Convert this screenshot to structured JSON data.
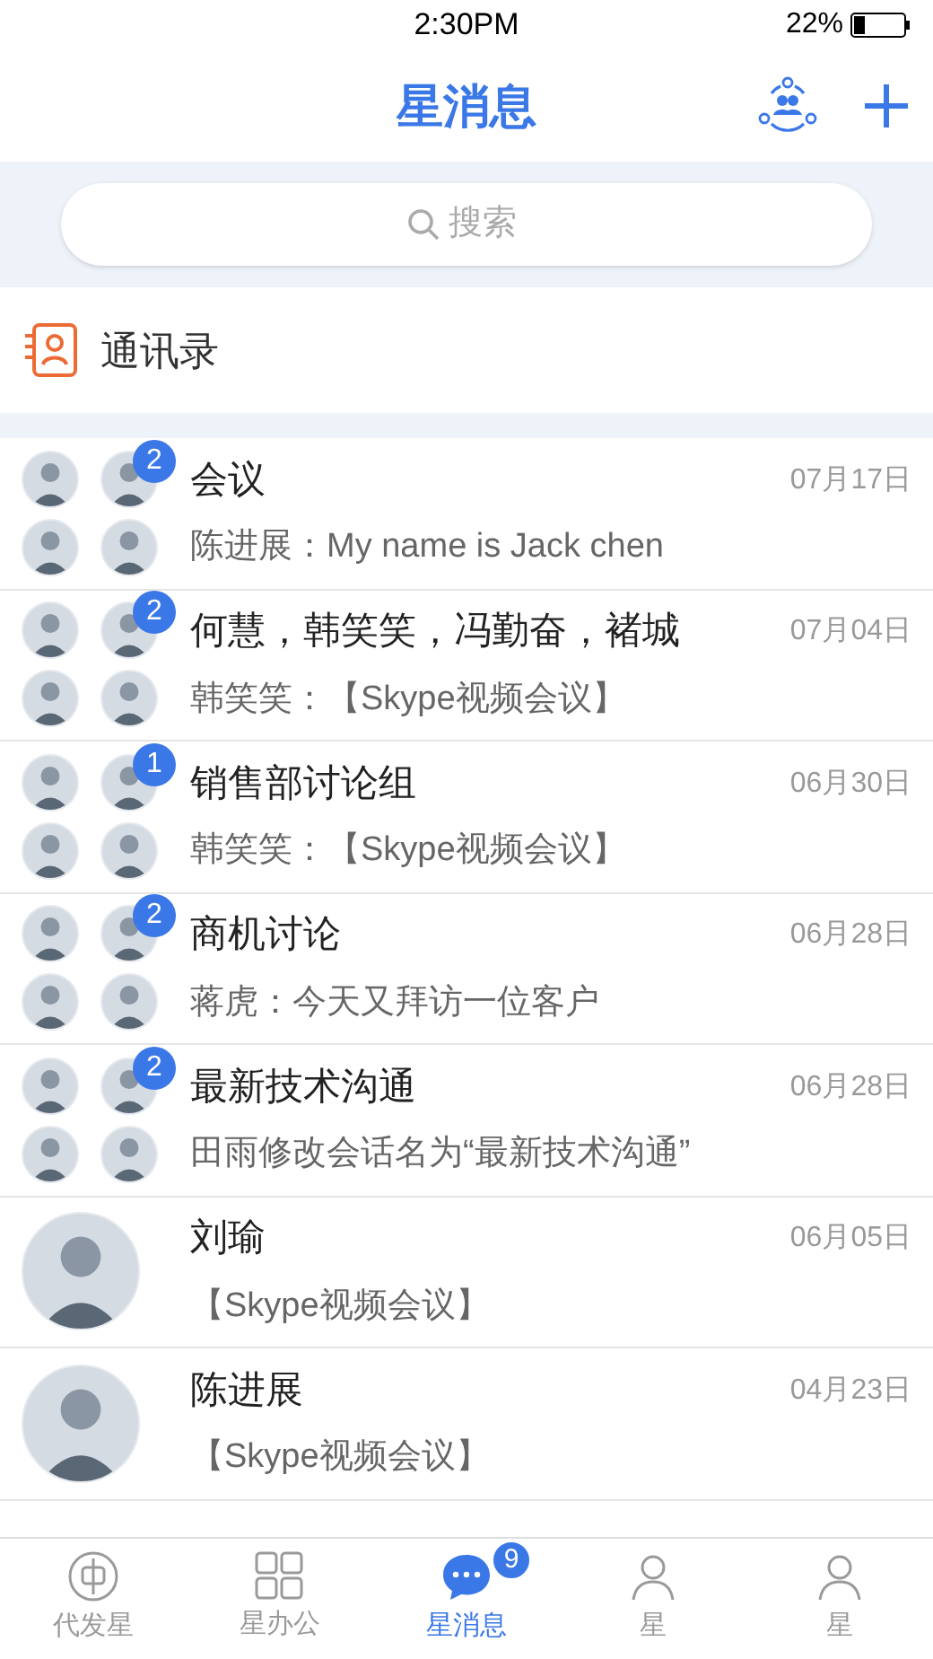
{
  "status_bar": {
    "time": "2:30PM",
    "battery": "22%"
  },
  "header": {
    "title": "星消息"
  },
  "search": {
    "placeholder": "搜索"
  },
  "contacts": {
    "label": "通讯录"
  },
  "conversations": [
    {
      "kind": "group",
      "name": "会议",
      "preview": "陈进展：My name is Jack chen",
      "date": "07月17日",
      "unread": "2"
    },
    {
      "kind": "group",
      "name": "何慧，韩笑笑，冯勤奋，褚城",
      "preview": "韩笑笑：【Skype视频会议】",
      "date": "07月04日",
      "unread": "2"
    },
    {
      "kind": "group",
      "name": "销售部讨论组",
      "preview": "韩笑笑：【Skype视频会议】",
      "date": "06月30日",
      "unread": "1"
    },
    {
      "kind": "group",
      "name": "商机讨论",
      "preview": "蒋虎：今天又拜访一位客户",
      "date": "06月28日",
      "unread": "2"
    },
    {
      "kind": "group",
      "name": "最新技术沟通",
      "preview": "田雨修改会话名为“最新技术沟通”",
      "date": "06月28日",
      "unread": "2"
    },
    {
      "kind": "person",
      "name": "刘瑜",
      "preview": "【Skype视频会议】",
      "date": "06月05日"
    },
    {
      "kind": "person",
      "name": "陈进展",
      "preview": "【Skype视频会议】",
      "date": "04月23日"
    }
  ],
  "tabs": [
    {
      "kind": "coin",
      "label": "代发星",
      "selected": false
    },
    {
      "kind": "grid",
      "label": "星办公",
      "selected": false
    },
    {
      "kind": "chat",
      "label": "星消息",
      "selected": true,
      "badge": "9"
    },
    {
      "kind": "people",
      "label": "星",
      "selected": false
    },
    {
      "kind": "people",
      "label": "星",
      "selected": false
    }
  ]
}
